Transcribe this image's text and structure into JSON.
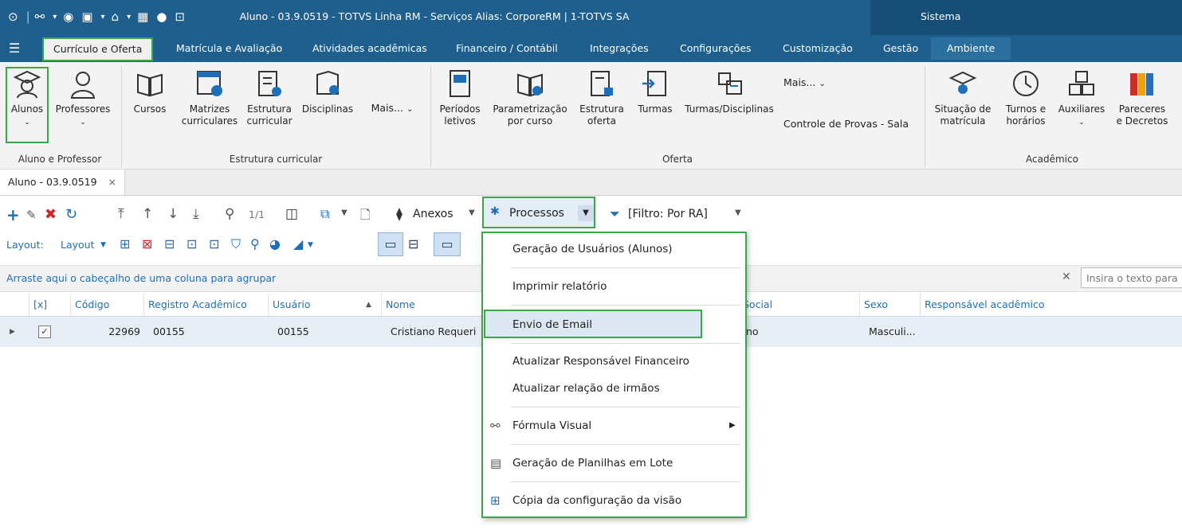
{
  "window": {
    "title": "Aluno - 03.9.0519 - TOTVS Linha RM - Serviços  Alias: CorporeRM | 1-TOTVS SA",
    "system_label": "Sistema"
  },
  "main_tabs": [
    {
      "label": "Currículo e Oferta",
      "active": true
    },
    {
      "label": "Matrícula e Avaliação"
    },
    {
      "label": "Atividades acadêmicas"
    },
    {
      "label": "Financeiro / Contábil"
    },
    {
      "label": "Integrações"
    },
    {
      "label": "Configurações"
    },
    {
      "label": "Customização"
    },
    {
      "label": "Gestão"
    },
    {
      "label": "Ambiente"
    }
  ],
  "ribbon": {
    "aluno_professor": {
      "label": "Aluno e Professor",
      "items": [
        {
          "label": "Alunos",
          "icon": "student-icon"
        },
        {
          "label": "Professores",
          "icon": "teacher-icon"
        }
      ]
    },
    "estrutura": {
      "label": "Estrutura curricular",
      "items": [
        {
          "label": "Cursos"
        },
        {
          "label1": "Matrizes",
          "label2": "curriculares"
        },
        {
          "label1": "Estrutura",
          "label2": "curricular"
        },
        {
          "label": "Disciplinas"
        }
      ],
      "more": "Mais..."
    },
    "oferta": {
      "label": "Oferta",
      "items": [
        {
          "label1": "Períodos",
          "label2": "letivos"
        },
        {
          "label1": "Parametrização",
          "label2": "por curso"
        },
        {
          "label1": "Estrutura",
          "label2": "oferta"
        },
        {
          "label": "Turmas"
        },
        {
          "label": "Turmas/Disciplinas"
        }
      ],
      "more": "Mais...",
      "controle": "Controle de Provas - Sala"
    },
    "academico": {
      "label": "Acadêmico",
      "items": [
        {
          "label1": "Situação de",
          "label2": "matrícula"
        },
        {
          "label1": "Turnos e",
          "label2": "horários"
        },
        {
          "label": "Auxiliares"
        },
        {
          "label1": "Pareceres",
          "label2": "e Decretos"
        }
      ]
    }
  },
  "doc_tab": {
    "label": "Aluno - 03.9.0519",
    "close": "×"
  },
  "toolbar": {
    "page": "1/1",
    "anexos": "Anexos",
    "processos": "Processos",
    "filtro": "[Filtro: Por RA]",
    "layout_label": "Layout:",
    "layout_btn": "Layout"
  },
  "group_hint": "Arraste aqui o cabeçalho de uma coluna para agrupar",
  "search_placeholder": "Insira o texto para",
  "grid": {
    "columns": [
      "[x]",
      "Código",
      "Registro Acadêmico",
      "Usuário",
      "Nome",
      "Social",
      "Sexo",
      "Responsável acadêmico"
    ],
    "row": {
      "codigo": "22969",
      "ra": "00155",
      "usuario": "00155",
      "nome": "Cristiano Requeri",
      "social": "no",
      "sexo": "Masculi..."
    }
  },
  "menu": {
    "items": [
      "Geração de Usuários (Alunos)",
      "Imprimir relatório",
      "Envio de Email",
      "Atualizar Responsável Financeiro",
      "Atualizar relação de irmãos",
      "Fórmula Visual",
      "Geração de Planilhas em Lote",
      "Cópia da configuração da visão"
    ]
  },
  "colors": {
    "accent": "#1e5f8e",
    "highlight": "#3aa84a",
    "link": "#1e6fb8"
  }
}
